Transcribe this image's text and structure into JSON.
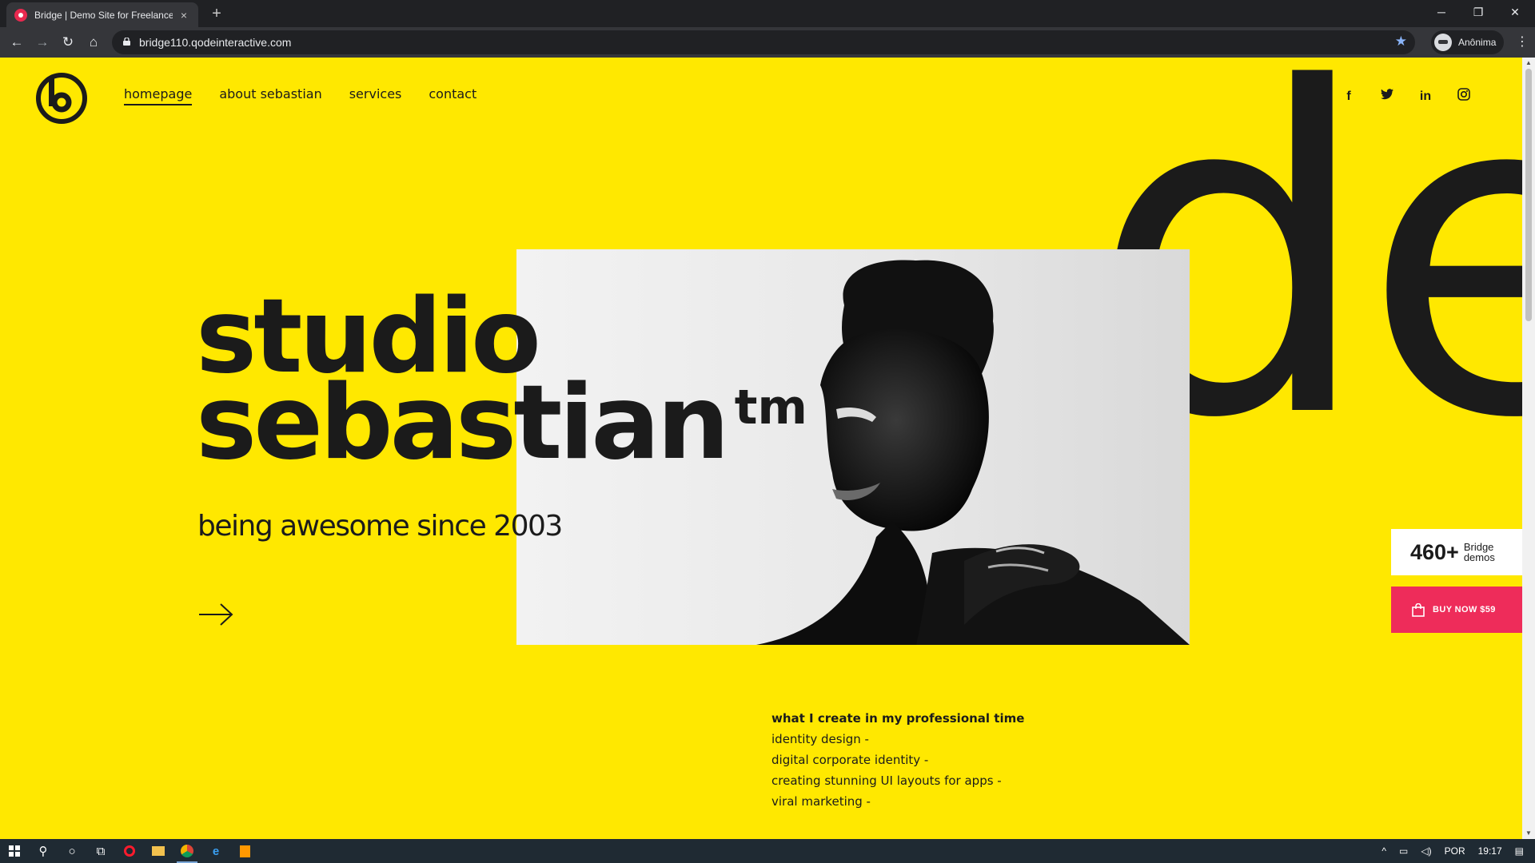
{
  "browser": {
    "tab_title": "Bridge | Demo Site for Freelancer",
    "tab_close": "×",
    "new_tab": "+",
    "url": "bridge110.qodeinteractive.com",
    "profile_label": "Anônima",
    "window_controls": [
      "─",
      "❐",
      "✕"
    ]
  },
  "nav": {
    "items": [
      "homepage",
      "about sebastian",
      "services",
      "contact"
    ],
    "active_index": 0
  },
  "socials": [
    "facebook-icon",
    "twitter-icon",
    "linkedin-icon",
    "instagram-icon"
  ],
  "hero": {
    "background_word": "des",
    "title_line1": "studio",
    "title_line2": "sebastian",
    "title_sup": "tm",
    "subtitle": "being awesome since 2003",
    "photo_alt": "black and white portrait"
  },
  "create": {
    "heading": "what I create in my professional time",
    "items": [
      "identity design -",
      "digital corporate identity -",
      "creating stunning UI layouts for apps -",
      "viral marketing -"
    ]
  },
  "promo": {
    "demos_count": "460+",
    "demos_line1": "Bridge",
    "demos_line2": "demos",
    "buy_label": "BUY NOW $59"
  },
  "taskbar": {
    "language": "POR",
    "time": "19:17"
  },
  "colors": {
    "page_bg": "#ffe800",
    "text": "#1b1b1b",
    "buy_button": "#ee2c5a",
    "browser_dark": "#202124",
    "taskbar": "#1f2a33"
  }
}
